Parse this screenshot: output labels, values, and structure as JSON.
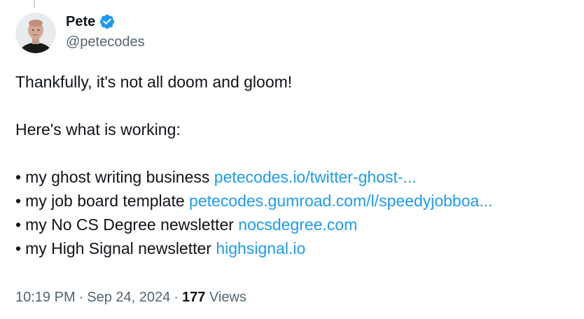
{
  "author": {
    "name": "Pete",
    "handle": "@petecodes",
    "verified": true,
    "avatar_icon": "avatar-photo"
  },
  "tweet": {
    "intro": "Thankfully, it's not all doom and gloom!",
    "lead": "Here's what is working:",
    "items": [
      {
        "bullet": "•",
        "text": "my ghost writing business",
        "link": "petecodes.io/twitter-ghost-..."
      },
      {
        "bullet": "•",
        "text": "my job board template",
        "link": "petecodes.gumroad.com/l/speedyjobboa..."
      },
      {
        "bullet": "•",
        "text": "my No CS Degree newsletter",
        "link": "nocsdegree.com"
      },
      {
        "bullet": "•",
        "text": "my High Signal newsletter",
        "link": "highsignal.io"
      }
    ]
  },
  "meta": {
    "time": "10:19 PM",
    "separator": "·",
    "date": "Sep 24, 2024",
    "views_count": "177",
    "views_label": "Views"
  },
  "colors": {
    "text": "#0f1419",
    "muted": "#536471",
    "link": "#1d9bf0",
    "verified": "#1d9bf0"
  }
}
